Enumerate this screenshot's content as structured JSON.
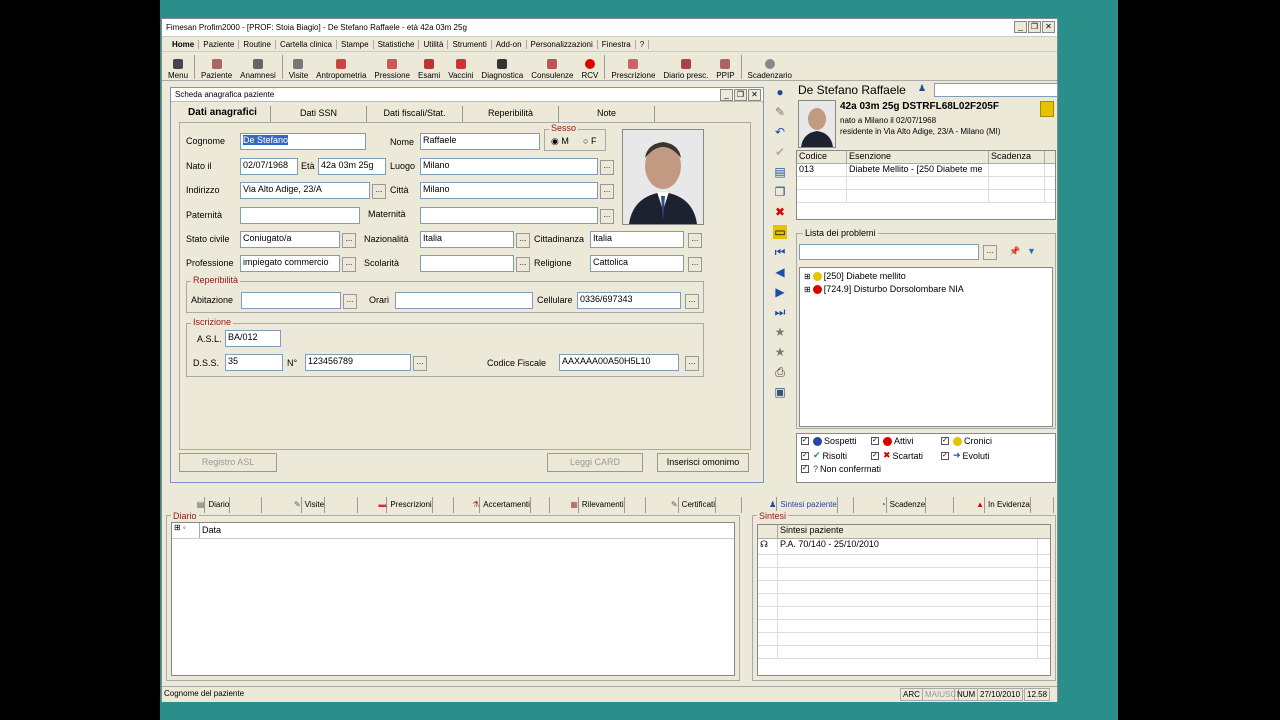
{
  "window": {
    "title": "Fimesan Profim2000 - [PROF: Stoia Biagio] - De Stefano Raffaele - età 42a 03m 25g"
  },
  "menu": [
    "Home",
    "Paziente",
    "Routine",
    "Cartella clinica",
    "Stampe",
    "Statistiche",
    "Utilità",
    "Strumenti",
    "Add-on",
    "Personalizzazioni",
    "Finestra",
    "?"
  ],
  "toolbar": [
    "Menu",
    "Paziente",
    "Anamnesi",
    "Visite",
    "Antropometria",
    "Pressione",
    "Esami",
    "Vaccini",
    "Diagnostica",
    "Consulenze",
    "RCV",
    "Prescrizione",
    "Diario presc.",
    "PPIP",
    "Scadenzario"
  ],
  "dialog": {
    "title": "Scheda anagrafica paziente",
    "tabs": [
      "Dati anagrafici",
      "Dati SSN",
      "Dati fiscali/Stat.",
      "Reperibilità",
      "Note"
    ]
  },
  "form": {
    "cognome_label": "Cognome",
    "cognome": "De Stefano",
    "nome_label": "Nome",
    "nome": "Raffaele",
    "sesso_label": "Sesso",
    "sesso_m": "M",
    "sesso_f": "F",
    "nato_label": "Nato il",
    "nato": "02/07/1968",
    "eta_label": "Età",
    "eta": "42a 03m 25g",
    "luogo_label": "Luogo",
    "luogo": "Milano",
    "indirizzo_label": "Indirizzo",
    "indirizzo": "Via Alto Adige, 23/A",
    "citta_label": "Città",
    "citta": "Milano",
    "paternita_label": "Paternità",
    "paternita": "",
    "maternita_label": "Maternità",
    "maternita": "",
    "stato_label": "Stato civile",
    "stato": "Coniugato/a",
    "naz_label": "Nazionalità",
    "naz": "Italia",
    "citt_label": "Cittadinanza",
    "citt": "Italia",
    "prof_label": "Professione",
    "prof": "impiegato commercio",
    "scol_label": "Scolarità",
    "scol": "",
    "rel_label": "Religione",
    "rel": "Cattolica",
    "rep_group": "Reperibilità",
    "abit_label": "Abitazione",
    "abit": "",
    "orari_label": "Orari",
    "orari": "",
    "cell_label": "Cellulare",
    "cell": "0336/697343",
    "isc_group": "Iscrizione",
    "asl_label": "A.S.L.",
    "asl": "BA/012",
    "dss_label": "D.S.S.",
    "dss": "35",
    "n_label": "N°",
    "n": "123456789",
    "cf_label": "Codice Fiscale",
    "cf": "AAXAAA00A50H5L10"
  },
  "dialog_buttons": {
    "registro": "Registro ASL",
    "leggi": "Leggi CARD",
    "omonimo": "Inserisci omonimo"
  },
  "patient": {
    "name": "De Stefano Raffaele",
    "age_code": "42a 03m 25g  DSTRFL68L02F205F",
    "born": "nato a Milano il 02/07/1968",
    "resident": "residente in Via Alto Adige, 23/A - Milano (MI)"
  },
  "esenzioni": {
    "headers": [
      "Codice",
      "Esenzione",
      "Scadenza"
    ],
    "rows": [
      [
        "013",
        "Diabete Mellito - [250 Diabete me",
        ""
      ]
    ]
  },
  "problems": {
    "title": "Lista dei problemi",
    "items": [
      "[250] Diabete mellito",
      "[724.9] Disturbo Dorsolombare NIA"
    ]
  },
  "legend": [
    "Sospetti",
    "Attivi",
    "Cronici",
    "Risolti",
    "Scartati",
    "Evoluti",
    "Non confermati"
  ],
  "bottom_tabs_left": [
    "Diario",
    "Visite",
    "Prescrizioni",
    "Accertamenti",
    "Rilevamenti",
    "Certificati"
  ],
  "bottom_tabs_right": [
    "Sintesi paziente",
    "Scadenze",
    "In Evidenza"
  ],
  "diario": {
    "title": "Diario",
    "col": "Data"
  },
  "sintesi": {
    "title": "Sintesi",
    "col": "Sintesi paziente",
    "row": "P.A. 70/140 - 25/10/2010"
  },
  "status": {
    "text": "Cognome del paziente",
    "arc": "ARC",
    "maiusc": "MAIUSC",
    "num": "NUM",
    "date": "27/10/2010",
    "time": "12.58"
  }
}
